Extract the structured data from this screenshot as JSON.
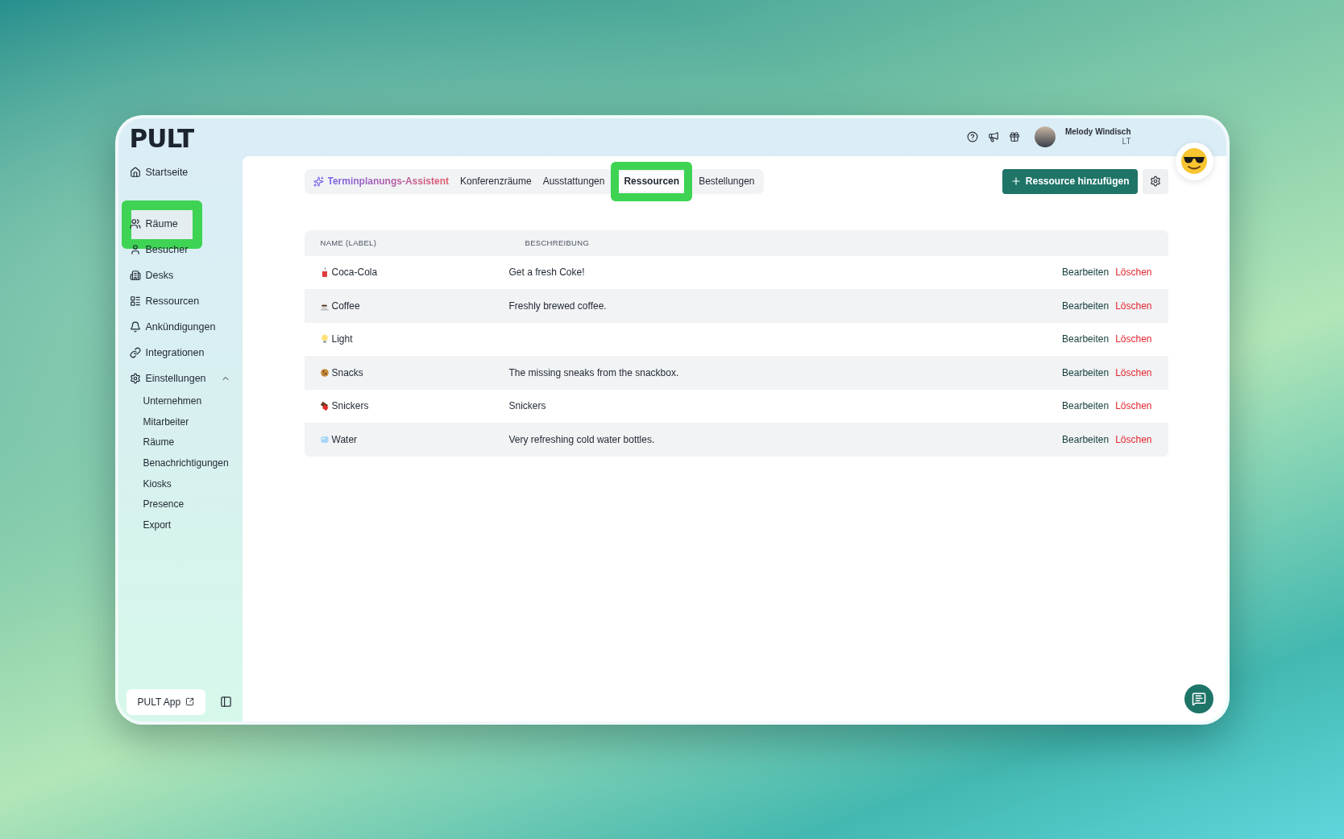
{
  "brand": {
    "logo": "PULT"
  },
  "topbar": {
    "user": {
      "name": "Melody Windisch",
      "company": "LT"
    }
  },
  "sidebar": {
    "items": [
      {
        "label": "Startseite",
        "highlighted": false
      },
      {
        "label": "Räume",
        "highlighted": true
      },
      {
        "label": "Besucher",
        "highlighted": false
      },
      {
        "label": "Desks",
        "highlighted": false
      },
      {
        "label": "Ressourcen",
        "highlighted": false
      },
      {
        "label": "Ankündigungen",
        "highlighted": false
      },
      {
        "label": "Integrationen",
        "highlighted": false
      }
    ],
    "settings": {
      "label": "Einstellungen",
      "expanded": true,
      "children": [
        {
          "label": "Unternehmen"
        },
        {
          "label": "Mitarbeiter"
        },
        {
          "label": "Räume"
        },
        {
          "label": "Benachrichtigungen"
        },
        {
          "label": "Kiosks"
        },
        {
          "label": "Presence"
        },
        {
          "label": "Export"
        }
      ]
    },
    "app_button": "PULT App"
  },
  "tabs": [
    {
      "label": "Terminplanungs-Assistent",
      "kind": "assistant",
      "selected": false,
      "highlighted": false
    },
    {
      "label": "Konferenzräume",
      "kind": "plain",
      "selected": false,
      "highlighted": false
    },
    {
      "label": "Ausstattungen",
      "kind": "plain",
      "selected": false,
      "highlighted": false
    },
    {
      "label": "Ressourcen",
      "kind": "plain",
      "selected": true,
      "highlighted": true
    },
    {
      "label": "Bestellungen",
      "kind": "plain",
      "selected": false,
      "highlighted": false
    }
  ],
  "primary_button": "Ressource hinzufügen",
  "table": {
    "columns": [
      "NAME (LABEL)",
      "BESCHREIBUNG"
    ],
    "rows": [
      {
        "kind": "soda",
        "name": "Coca-Cola",
        "description": "Get a fresh Coke!",
        "edit": "Bearbeiten",
        "delete": "Löschen"
      },
      {
        "kind": "coffee",
        "name": "Coffee",
        "description": "Freshly brewed coffee.",
        "edit": "Bearbeiten",
        "delete": "Löschen"
      },
      {
        "kind": "bulb",
        "name": "Light",
        "edit": "Bearbeiten",
        "delete": "Löschen"
      },
      {
        "kind": "cookie",
        "name": "Snacks",
        "description": "The missing sneaks from the snackbox.",
        "edit": "Bearbeiten",
        "delete": "Löschen"
      },
      {
        "kind": "chocolate",
        "name": "Snickers",
        "description": "Snickers",
        "edit": "Bearbeiten",
        "delete": "Löschen"
      },
      {
        "kind": "ice",
        "name": "Water",
        "description": "Very refreshing cold water bottles.",
        "edit": "Bearbeiten",
        "delete": "Löschen"
      }
    ]
  }
}
